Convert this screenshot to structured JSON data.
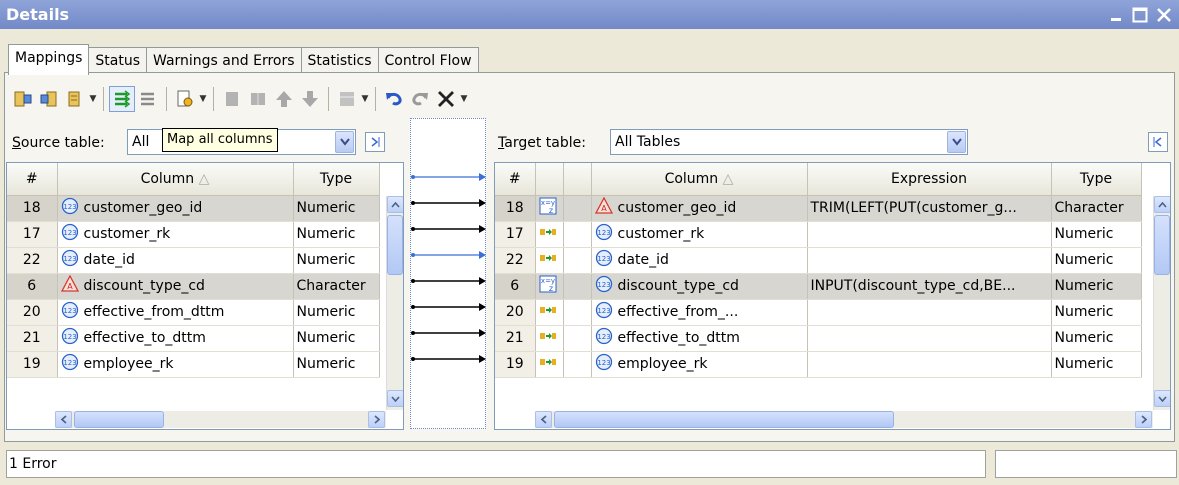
{
  "window": {
    "title": "Details"
  },
  "tabs": [
    {
      "label": "Mappings",
      "active": true
    },
    {
      "label": "Status"
    },
    {
      "label": "Warnings and Errors"
    },
    {
      "label": "Statistics"
    },
    {
      "label": "Control Flow"
    }
  ],
  "tooltip": "Map all columns",
  "source": {
    "label_accel": "S",
    "label_rest": "ource table:",
    "combo_value": "All",
    "columns": [
      "#",
      "Column",
      "Type"
    ],
    "rows": [
      {
        "num": "18",
        "icon": "numeric",
        "name": "customer_geo_id",
        "type": "Numeric",
        "selected": true
      },
      {
        "num": "17",
        "icon": "numeric",
        "name": "customer_rk",
        "type": "Numeric"
      },
      {
        "num": "22",
        "icon": "numeric",
        "name": "date_id",
        "type": "Numeric"
      },
      {
        "num": "6",
        "icon": "character",
        "name": "discount_type_cd",
        "type": "Character",
        "selected": true
      },
      {
        "num": "20",
        "icon": "numeric",
        "name": "effective_from_dttm",
        "type": "Numeric"
      },
      {
        "num": "21",
        "icon": "numeric",
        "name": "effective_to_dttm",
        "type": "Numeric"
      },
      {
        "num": "19",
        "icon": "numeric",
        "name": "employee_rk",
        "type": "Numeric"
      }
    ]
  },
  "target": {
    "label_accel": "T",
    "label_rest": "arget table:",
    "combo_value": "All Tables",
    "columns": [
      "#",
      "",
      "",
      "Column",
      "Expression",
      "Type"
    ],
    "rows": [
      {
        "num": "18",
        "map": "expression",
        "icon": "character",
        "name": "customer_geo_id",
        "expr": "TRIM(LEFT(PUT(customer_g...",
        "type": "Character",
        "selected": true
      },
      {
        "num": "17",
        "map": "direct",
        "icon": "numeric",
        "name": "customer_rk",
        "expr": "",
        "type": "Numeric"
      },
      {
        "num": "22",
        "map": "direct",
        "icon": "numeric",
        "name": "date_id",
        "expr": "",
        "type": "Numeric"
      },
      {
        "num": "6",
        "map": "expression",
        "icon": "numeric",
        "name": "discount_type_cd",
        "expr": "INPUT(discount_type_cd,BE...",
        "type": "Numeric",
        "selected": true
      },
      {
        "num": "20",
        "map": "direct",
        "icon": "numeric",
        "name": "effective_from_...",
        "expr": "",
        "type": "Numeric"
      },
      {
        "num": "21",
        "map": "direct",
        "icon": "numeric",
        "name": "effective_to_dttm",
        "expr": "",
        "type": "Numeric"
      },
      {
        "num": "19",
        "map": "direct",
        "icon": "numeric",
        "name": "employee_rk",
        "expr": "",
        "type": "Numeric"
      }
    ]
  },
  "mappings": [
    {
      "source_row": 0,
      "target_row": 0,
      "kind": "expression"
    },
    {
      "source_row": 1,
      "target_row": 1,
      "kind": "direct"
    },
    {
      "source_row": 2,
      "target_row": 2,
      "kind": "direct"
    },
    {
      "source_row": 3,
      "target_row": 3,
      "kind": "expression"
    },
    {
      "source_row": 4,
      "target_row": 4,
      "kind": "direct"
    },
    {
      "source_row": 5,
      "target_row": 5,
      "kind": "direct"
    },
    {
      "source_row": 6,
      "target_row": 6,
      "kind": "direct"
    },
    {
      "source_row": 7,
      "target_row": 7,
      "kind": "direct"
    }
  ],
  "status": {
    "text": "1 Error",
    "right": ""
  },
  "colors": {
    "title_bar": "#7c90cc",
    "selected_row": "#d8d6d0",
    "mapping_line_expression": "#3a6fd8",
    "mapping_line_direct": "#000000"
  }
}
